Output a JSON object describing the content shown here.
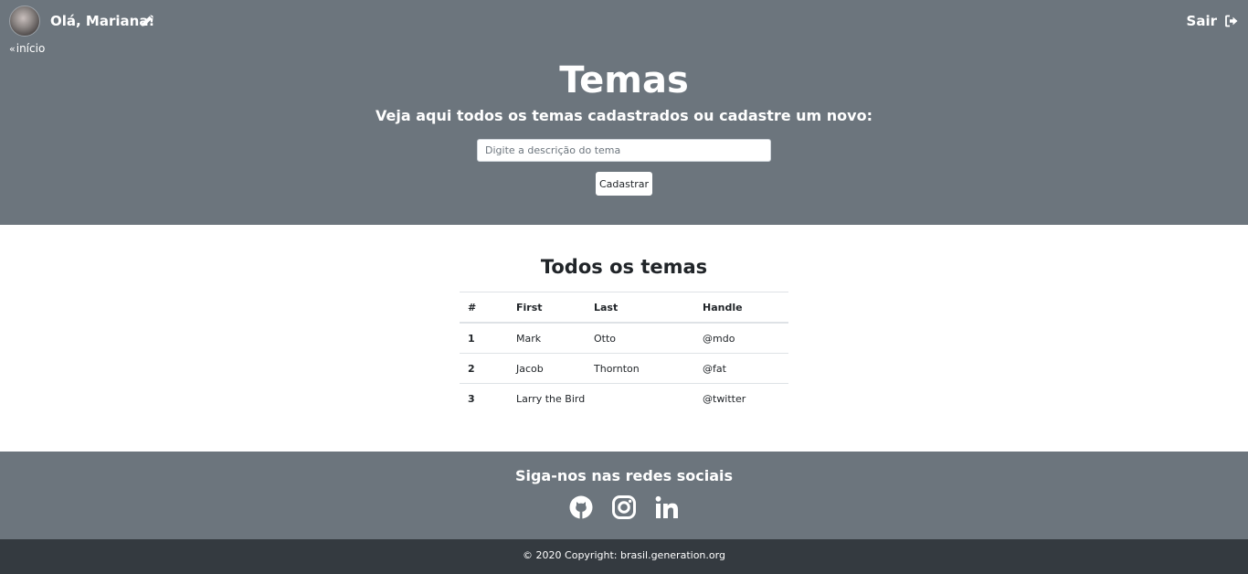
{
  "header": {
    "greeting": "Olá, Mariana!",
    "logout_label": "Sair",
    "back_link": "início",
    "title": "Temas",
    "subtitle": "Veja aqui todos os temas cadastrados ou cadastre um novo:",
    "input_placeholder": "Digite a descrição do tema",
    "input_value": "",
    "submit_label": "Cadastrar"
  },
  "main": {
    "section_title": "Todos os temas",
    "table": {
      "columns": [
        "#",
        "First",
        "Last",
        "Handle"
      ],
      "rows": [
        [
          "1",
          "Mark",
          "Otto",
          "@mdo"
        ],
        [
          "2",
          "Jacob",
          "Thornton",
          "@fat"
        ],
        [
          "3",
          "Larry the Bird",
          "",
          "@twitter"
        ]
      ]
    }
  },
  "footer": {
    "social_title": "Siga-nos nas redes sociais",
    "social_icons": [
      "github-icon",
      "instagram-icon",
      "linkedin-icon"
    ],
    "copyright": "© 2020 Copyright: brasil.generation.org"
  },
  "colors": {
    "header_bg": "#6c757d",
    "footer_bg": "#343a40",
    "text_light": "#ffffff"
  }
}
